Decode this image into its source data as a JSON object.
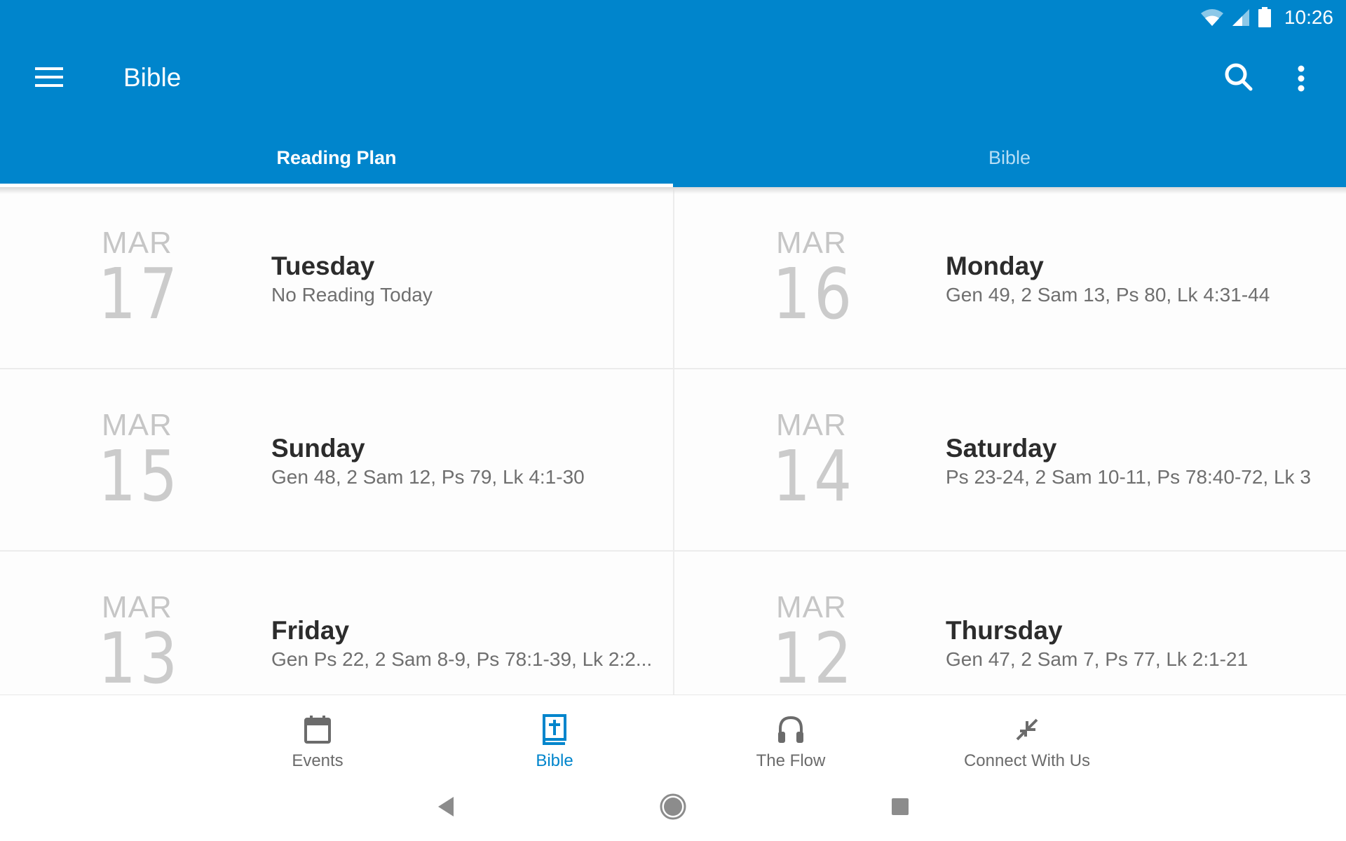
{
  "status_bar": {
    "time": "10:26",
    "icons": [
      "wifi-icon",
      "cell-signal-icon",
      "battery-icon"
    ]
  },
  "app_bar": {
    "title": "Bible",
    "menu_icon": "hamburger-menu-icon",
    "actions": [
      "search-icon",
      "more-vert-icon"
    ]
  },
  "tabs": [
    {
      "label": "Reading Plan",
      "selected": true
    },
    {
      "label": "Bible",
      "selected": false
    }
  ],
  "reading_plan": [
    {
      "month": "MAR",
      "day": "17",
      "weekday": "Tuesday",
      "reading": "No Reading Today"
    },
    {
      "month": "MAR",
      "day": "16",
      "weekday": "Monday",
      "reading": "Gen 49, 2 Sam 13, Ps 80, Lk 4:31-44"
    },
    {
      "month": "MAR",
      "day": "15",
      "weekday": "Sunday",
      "reading": "Gen 48, 2 Sam 12, Ps 79, Lk 4:1-30"
    },
    {
      "month": "MAR",
      "day": "14",
      "weekday": "Saturday",
      "reading": "Ps 23-24, 2 Sam 10-11, Ps 78:40-72, Lk 3"
    },
    {
      "month": "MAR",
      "day": "13",
      "weekday": "Friday",
      "reading": "Gen Ps 22, 2 Sam 8-9, Ps 78:1-39, Lk 2:2..."
    },
    {
      "month": "MAR",
      "day": "12",
      "weekday": "Thursday",
      "reading": "Gen 47, 2 Sam 7, Ps 77, Lk 2:1-21"
    }
  ],
  "bottom_nav": [
    {
      "label": "Events",
      "icon": "calendar-icon",
      "active": false
    },
    {
      "label": "Bible",
      "icon": "bible-book-icon",
      "active": true
    },
    {
      "label": "The Flow",
      "icon": "headphones-icon",
      "active": false
    },
    {
      "label": "Connect With Us",
      "icon": "connect-arrows-icon",
      "active": false
    }
  ],
  "system_nav": [
    "back-icon",
    "home-icon",
    "recents-icon"
  ],
  "colors": {
    "primary": "#0085cc",
    "tab_inactive": "#b7def5",
    "text_dark": "#2c2c2c",
    "text_muted": "#6f6f6f",
    "date_gray": "#c6c6c6",
    "nav_gray": "#6b6b6b"
  }
}
